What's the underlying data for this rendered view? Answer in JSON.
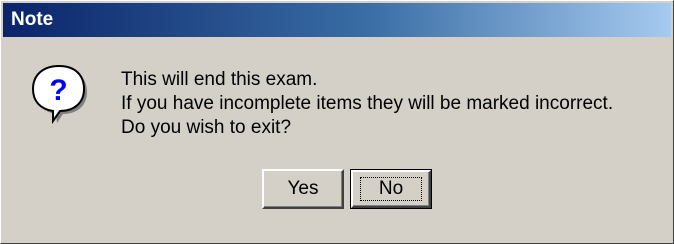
{
  "dialog": {
    "title": "Note",
    "icon": "question-icon",
    "message_lines": [
      "This will end this exam.",
      "If you have incomplete items they will be marked incorrect.",
      "Do you wish to exit?"
    ],
    "buttons": {
      "yes_label": "Yes",
      "no_label": "No"
    },
    "colors": {
      "title_bar_start": "#0a246a",
      "title_bar_end": "#a6caf0",
      "face": "#d4d0c8"
    }
  }
}
